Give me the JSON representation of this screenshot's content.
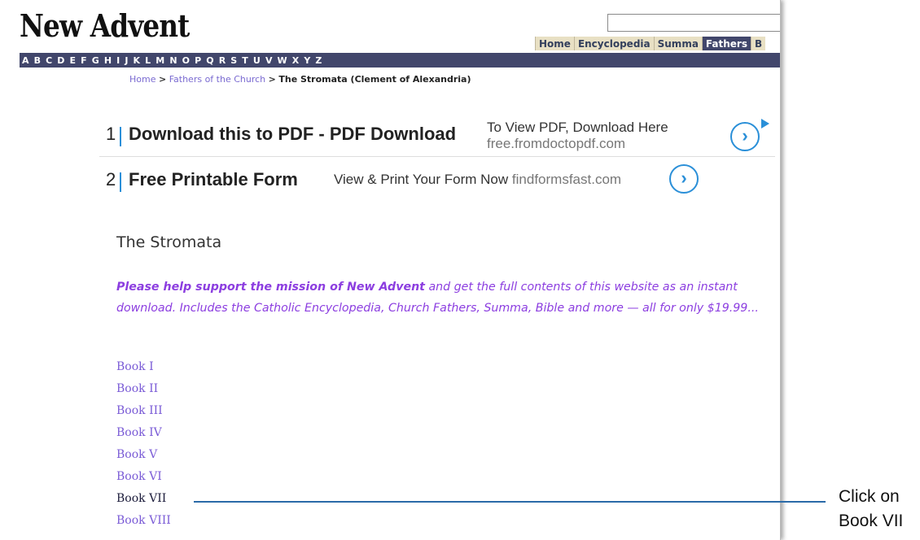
{
  "header": {
    "logo": "New Advent",
    "nav": [
      "Home",
      "Encyclopedia",
      "Summa",
      "Fathers",
      "B"
    ],
    "active_nav": "Fathers",
    "alphabet": [
      "A",
      "B",
      "C",
      "D",
      "E",
      "F",
      "G",
      "H",
      "I",
      "J",
      "K",
      "L",
      "M",
      "N",
      "O",
      "P",
      "Q",
      "R",
      "S",
      "T",
      "U",
      "V",
      "W",
      "X",
      "Y",
      "Z"
    ]
  },
  "breadcrumb": {
    "home": "Home",
    "sep1": ">",
    "section": "Fathers of the Church",
    "sep2": ">",
    "current": "The Stromata (Clement of Alexandria)"
  },
  "ads": [
    {
      "num": "1",
      "title": "Download this to PDF - PDF Download",
      "desc": "To View PDF, Download Here",
      "url": "free.fromdoctopdf.com"
    },
    {
      "num": "2",
      "title": "Free Printable Form",
      "desc": "View & Print Your Form Now",
      "url": "findformsfast.com"
    }
  ],
  "content": {
    "title": "The Stromata",
    "promo_bold": "Please help support the mission of New Advent",
    "promo_rest": " and get the full contents of this website as an instant download. Includes the Catholic Encyclopedia, Church Fathers, Summa, Bible and more — all for only $19.99...",
    "books": [
      "Book I",
      "Book II",
      "Book III",
      "Book IV",
      "Book V",
      "Book VI",
      "Book VII",
      "Book VIII"
    ],
    "highlighted_book": "Book VII"
  },
  "annotation": {
    "line1": "Click on",
    "line2": "Book VII"
  },
  "colors": {
    "nav_bar": "#41466b",
    "nav_tab": "#e8e0c4",
    "link": "#7a5bd6",
    "promo": "#8c3ee0",
    "ad_accent": "#2a8fd8",
    "callout_line": "#2a6aa8"
  },
  "icons": {
    "ad_arrow": "chevron-right-icon",
    "ad_choices": "adchoices-icon"
  }
}
